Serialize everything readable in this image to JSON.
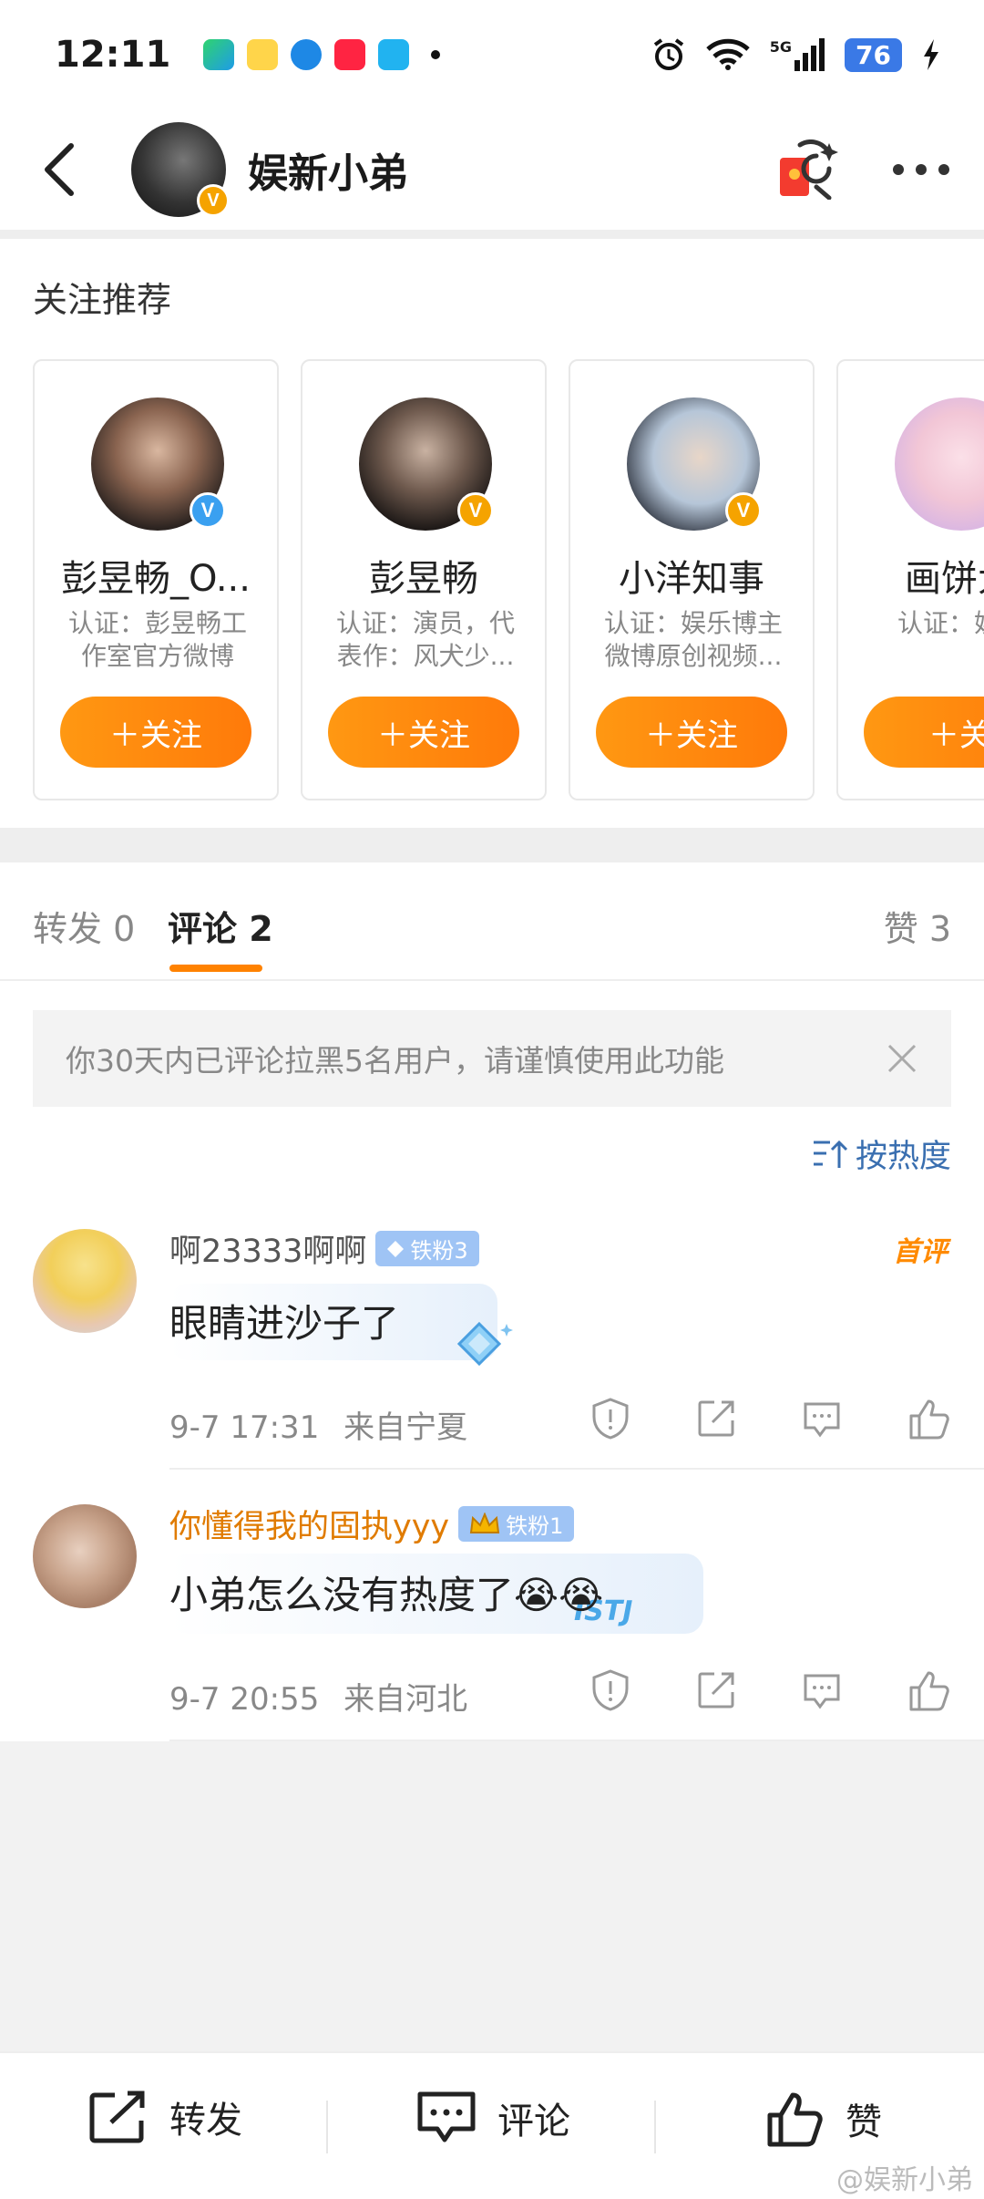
{
  "status_bar": {
    "time": "12:11",
    "battery": "76",
    "network": "5G"
  },
  "header": {
    "title": "娱新小弟"
  },
  "recommend": {
    "title": "关注推荐",
    "cards": [
      {
        "name": "彭昱畅_O...",
        "desc": "认证：彭昱畅工作室官方微博",
        "button": "＋关注",
        "badge": "blue"
      },
      {
        "name": "彭昱畅",
        "desc": "认证：演员，代表作：风犬少...",
        "button": "＋关注",
        "badge": "orange"
      },
      {
        "name": "小洋知事",
        "desc": "认证：娱乐博主 微博原创视频...",
        "button": "＋关注",
        "badge": "orange"
      },
      {
        "name": "画饼大",
        "desc": "认证：娱乐",
        "button": "＋关",
        "badge": "none"
      }
    ]
  },
  "tabs": {
    "repost": "转发 0",
    "comment": "评论 2",
    "like": "赞 3"
  },
  "notice": {
    "text": "你30天内已评论拉黑5名用户，请谨慎使用此功能"
  },
  "sort": {
    "label": "按热度"
  },
  "comments": [
    {
      "user": "啊23333啊啊",
      "badge": "铁粉3",
      "text": "眼睛进沙子了",
      "time": "9-7 17:31",
      "location": "来自宁夏",
      "tag": "首评"
    },
    {
      "user": "你懂得我的固执yyy",
      "badge": "铁粉1",
      "text": "小弟怎么没有热度了😭😭",
      "time": "9-7 20:55",
      "location": "来自河北",
      "deco": "ISTJ"
    }
  ],
  "bottom_bar": {
    "repost": "转发",
    "comment": "评论",
    "like": "赞"
  },
  "watermark": "@娱新小弟"
}
